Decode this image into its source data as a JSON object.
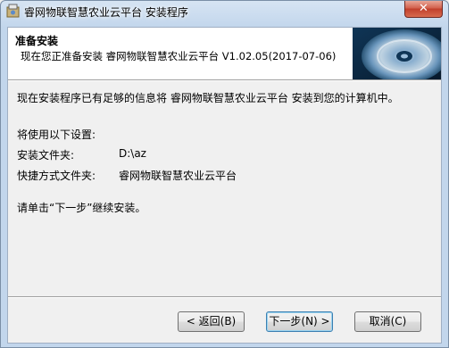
{
  "window": {
    "title": "睿网物联智慧农业云平台 安装程序",
    "close_label": "✕"
  },
  "header": {
    "title": "准备安装",
    "subtitle": "现在您正准备安装 睿网物联智慧农业云平台 V1.02.05(2017-07-06)"
  },
  "content": {
    "intro": "现在安装程序已有足够的信息将 睿网物联智慧农业云平台 安装到您的计算机中。",
    "settings_heading": "将使用以下设置:",
    "install_folder_label": "安装文件夹:",
    "install_folder_value": "D:\\az",
    "shortcut_folder_label": "快捷方式文件夹:",
    "shortcut_folder_value": "睿网物联智慧农业云平台",
    "instruction": "请单击“下一步”继续安装。"
  },
  "buttons": {
    "back": "< 返回(B)",
    "next": "下一步(N) >",
    "cancel": "取消(C)"
  },
  "colors": {
    "accent_default_button": "#3c7fb1",
    "close_button": "#c0402c"
  }
}
